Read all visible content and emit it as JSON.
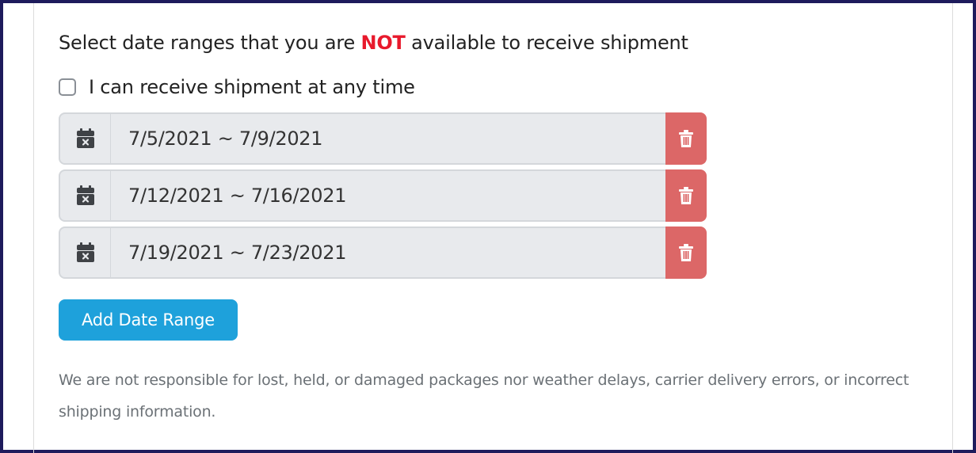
{
  "heading": {
    "before": "Select date ranges that you are ",
    "emphasis": "NOT",
    "after": " available to receive shipment",
    "emphasis_color": "#e8192c"
  },
  "any_time": {
    "label": "I can receive shipment at any time",
    "checked": false
  },
  "date_ranges": [
    {
      "value": "7/5/2021 ~ 7/9/2021",
      "icon": "calendar-x-icon",
      "action_icon": "trash-icon"
    },
    {
      "value": "7/12/2021 ~ 7/16/2021",
      "icon": "calendar-x-icon",
      "action_icon": "trash-icon"
    },
    {
      "value": "7/19/2021 ~ 7/23/2021",
      "icon": "calendar-x-icon",
      "action_icon": "trash-icon"
    }
  ],
  "add_button": {
    "label": "Add Date Range",
    "color": "#1ea1db"
  },
  "delete_color": "#dc6767",
  "disclaimer": "We are not responsible for lost, held, or damaged packages nor weather delays, carrier delivery errors, or incorrect shipping information."
}
